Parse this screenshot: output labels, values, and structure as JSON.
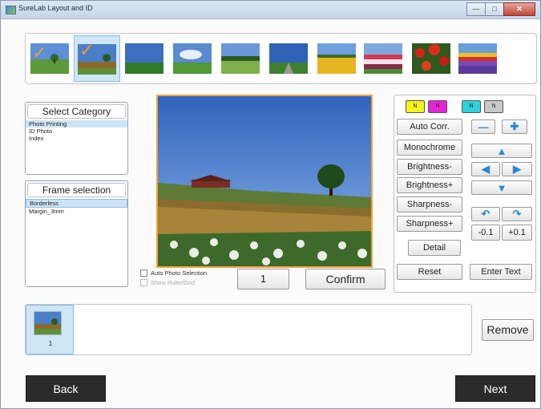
{
  "window": {
    "title": "SureLab Layout and ID",
    "controls": {
      "minimize": "—",
      "maximize": "□",
      "close": "✕"
    }
  },
  "thumbnails": [
    {
      "name": "tree-field",
      "checked": true
    },
    {
      "name": "barn-field",
      "checked": true,
      "selected": true
    },
    {
      "name": "sky-horizon"
    },
    {
      "name": "cloud-field"
    },
    {
      "name": "tree-row-field"
    },
    {
      "name": "road-sky"
    },
    {
      "name": "sunflower-field"
    },
    {
      "name": "striped-hills"
    },
    {
      "name": "red-tulips"
    },
    {
      "name": "lavender-rows"
    }
  ],
  "category": {
    "title": "Select Category",
    "items": [
      "Photo Printing",
      "ID Photo",
      "Index"
    ],
    "selected_index": 0
  },
  "frame": {
    "title": "Frame selection",
    "items": [
      "Borderless",
      "Margin_3mm"
    ],
    "selected_index": 0
  },
  "options": {
    "auto_photo_selection": "Auto Photo Selection",
    "show_ruler_grid": "Show Ruler/Grid"
  },
  "copies": "1",
  "confirm_label": "Confirm",
  "color_chips": [
    {
      "label": "N",
      "color": "#f7f21b"
    },
    {
      "label": "N",
      "color": "#e625d6"
    },
    {
      "label": "N",
      "color": "#2bd3d9"
    },
    {
      "label": "N",
      "color": "#c9c9c9"
    }
  ],
  "adjust_buttons": {
    "auto_corr": "Auto Corr.",
    "monochrome": "Monochrome",
    "brightness_minus": "Brightness-",
    "brightness_plus": "Brightness+",
    "sharpness_minus": "Sharpness-",
    "sharpness_plus": "Sharpness+",
    "detail": "Detail",
    "reset": "Reset",
    "enter_text": "Enter Text",
    "minus_0_1": "-0.1",
    "plus_0_1": "+0.1"
  },
  "layout_items": [
    {
      "number": "1"
    }
  ],
  "remove_label": "Remove",
  "back_label": "Back",
  "next_label": "Next"
}
